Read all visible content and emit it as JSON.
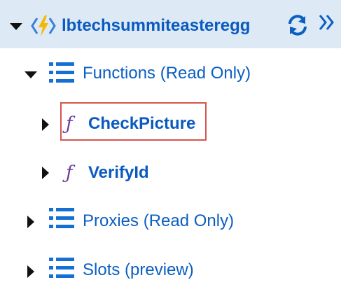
{
  "header": {
    "app_name": "lbtechsummiteasteregg",
    "app_icon": "function-app-icon",
    "refresh_icon": "refresh-icon",
    "expand_icon": "double-chevron-right-icon"
  },
  "tree": {
    "functions_label": "Functions (Read Only)",
    "functions": [
      {
        "label": "CheckPicture",
        "icon_glyph": "ƒ",
        "selected": true
      },
      {
        "label": "VerifyId",
        "icon_glyph": "ƒ",
        "selected": false
      }
    ],
    "proxies_label": "Proxies (Read Only)",
    "slots_label": "Slots (preview)"
  },
  "colors": {
    "accent": "#0b5fc1",
    "header_bg": "#ddeaf6",
    "selection_border": "#d6544e",
    "function_icon": "#6c3a9b"
  }
}
